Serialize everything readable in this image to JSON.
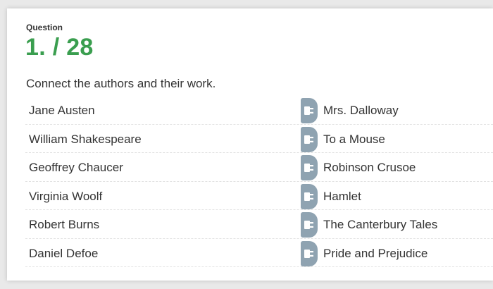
{
  "question": {
    "label": "Question",
    "number": "1. / 28",
    "instruction": "Connect the authors and their work."
  },
  "rows": [
    {
      "author": "Jane Austen",
      "work": "Mrs. Dalloway"
    },
    {
      "author": "William Shakespeare",
      "work": "To a Mouse"
    },
    {
      "author": "Geoffrey Chaucer",
      "work": "Robinson Crusoe"
    },
    {
      "author": "Virginia Woolf",
      "work": "Hamlet"
    },
    {
      "author": "Robert Burns",
      "work": "The Canterbury Tales"
    },
    {
      "author": "Daniel Defoe",
      "work": "Pride and Prejudice"
    }
  ],
  "colors": {
    "accent": "#3a9e4f",
    "handle": "#8fa3b1"
  },
  "icons": {
    "handle": "plug-icon"
  }
}
